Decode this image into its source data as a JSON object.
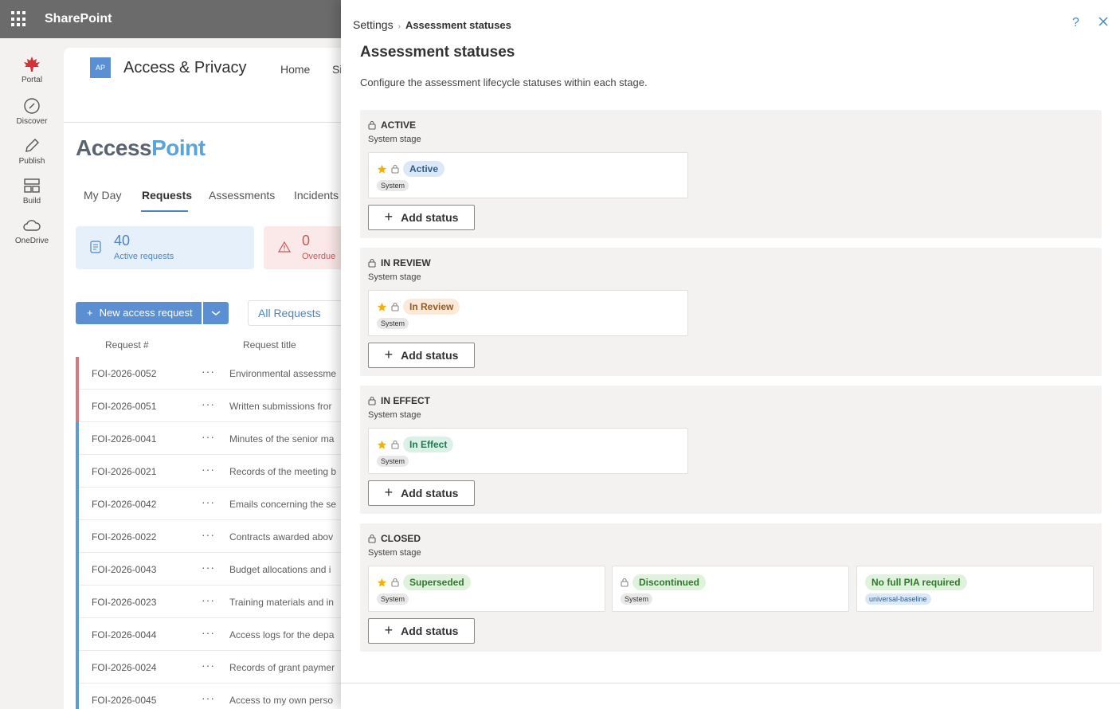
{
  "suite": {
    "title": "SharePoint"
  },
  "appbar": {
    "items": [
      {
        "label": "Portal",
        "icon": "maple-leaf-icon"
      },
      {
        "label": "Discover",
        "icon": "compass-icon"
      },
      {
        "label": "Publish",
        "icon": "pencil-icon"
      },
      {
        "label": "Build",
        "icon": "layout-icon"
      },
      {
        "label": "OneDrive",
        "icon": "cloud-icon"
      }
    ]
  },
  "site": {
    "logo": "AP",
    "title": "Access & Privacy",
    "nav": {
      "home": "Home",
      "si": "Si"
    },
    "brand": {
      "part1": "Access",
      "part2": "Point"
    },
    "tabs": [
      "My Day",
      "Requests",
      "Assessments",
      "Incidents"
    ],
    "cards": [
      {
        "value": "40",
        "label": "Active requests"
      },
      {
        "value": "0",
        "label": "Overdue"
      }
    ],
    "new_request": "New access request",
    "view": "All Requests",
    "columns": [
      "Request #",
      "Request title"
    ],
    "rows": [
      {
        "id": "FOI-2026-0052",
        "title": "Environmental assessme",
        "color": "#d9777a"
      },
      {
        "id": "FOI-2026-0051",
        "title": "Written submissions fror",
        "color": "#d9777a"
      },
      {
        "id": "FOI-2026-0041",
        "title": "Minutes of the senior ma",
        "color": "#5a9bd5"
      },
      {
        "id": "FOI-2026-0021",
        "title": "Records of the meeting b",
        "color": "#5a9bd5"
      },
      {
        "id": "FOI-2026-0042",
        "title": "Emails concerning the se",
        "color": "#5a9bd5"
      },
      {
        "id": "FOI-2026-0022",
        "title": "Contracts awarded abov",
        "color": "#5a9bd5"
      },
      {
        "id": "FOI-2026-0043",
        "title": "Budget allocations and i",
        "color": "#5a9bd5"
      },
      {
        "id": "FOI-2026-0023",
        "title": "Training materials and in",
        "color": "#5a9bd5"
      },
      {
        "id": "FOI-2026-0044",
        "title": "Access logs for the depa",
        "color": "#5a9bd5"
      },
      {
        "id": "FOI-2026-0024",
        "title": "Records of grant paymer",
        "color": "#5a9bd5"
      },
      {
        "id": "FOI-2026-0045",
        "title": "Access to my own perso",
        "color": "#5a9bd5"
      }
    ]
  },
  "panel": {
    "breadcrumb_root": "Settings",
    "breadcrumb_sep": "›",
    "breadcrumb_current": "Assessment statuses",
    "help": "?",
    "title": "Assessment statuses",
    "description": "Configure the assessment lifecycle statuses within each stage.",
    "add_label": "Add status",
    "stages": [
      {
        "name": "ACTIVE",
        "sub": "System stage",
        "statuses": [
          {
            "label": "Active",
            "tag": "System",
            "star": true,
            "lock": true,
            "bg": "#dbe8f7",
            "fg": "#2f5d8c"
          }
        ]
      },
      {
        "name": "IN REVIEW",
        "sub": "System stage",
        "statuses": [
          {
            "label": "In Review",
            "tag": "System",
            "star": true,
            "lock": true,
            "bg": "#fbe9d9",
            "fg": "#9a5a1f"
          }
        ]
      },
      {
        "name": "IN EFFECT",
        "sub": "System stage",
        "statuses": [
          {
            "label": "In Effect",
            "tag": "System",
            "star": true,
            "lock": true,
            "bg": "#dbf1e8",
            "fg": "#1f7a52"
          }
        ]
      },
      {
        "name": "CLOSED",
        "sub": "System stage",
        "statuses": [
          {
            "label": "Superseded",
            "tag": "System",
            "star": true,
            "lock": true,
            "bg": "#def2dc",
            "fg": "#2f7a2a"
          },
          {
            "label": "Discontinued",
            "tag": "System",
            "star": false,
            "lock": true,
            "bg": "#def2dc",
            "fg": "#2f7a2a"
          },
          {
            "label": "No full PIA required",
            "tag": "universal-baseline",
            "star": false,
            "lock": false,
            "bg": "#def2dc",
            "fg": "#2f7a2a"
          }
        ]
      }
    ]
  }
}
